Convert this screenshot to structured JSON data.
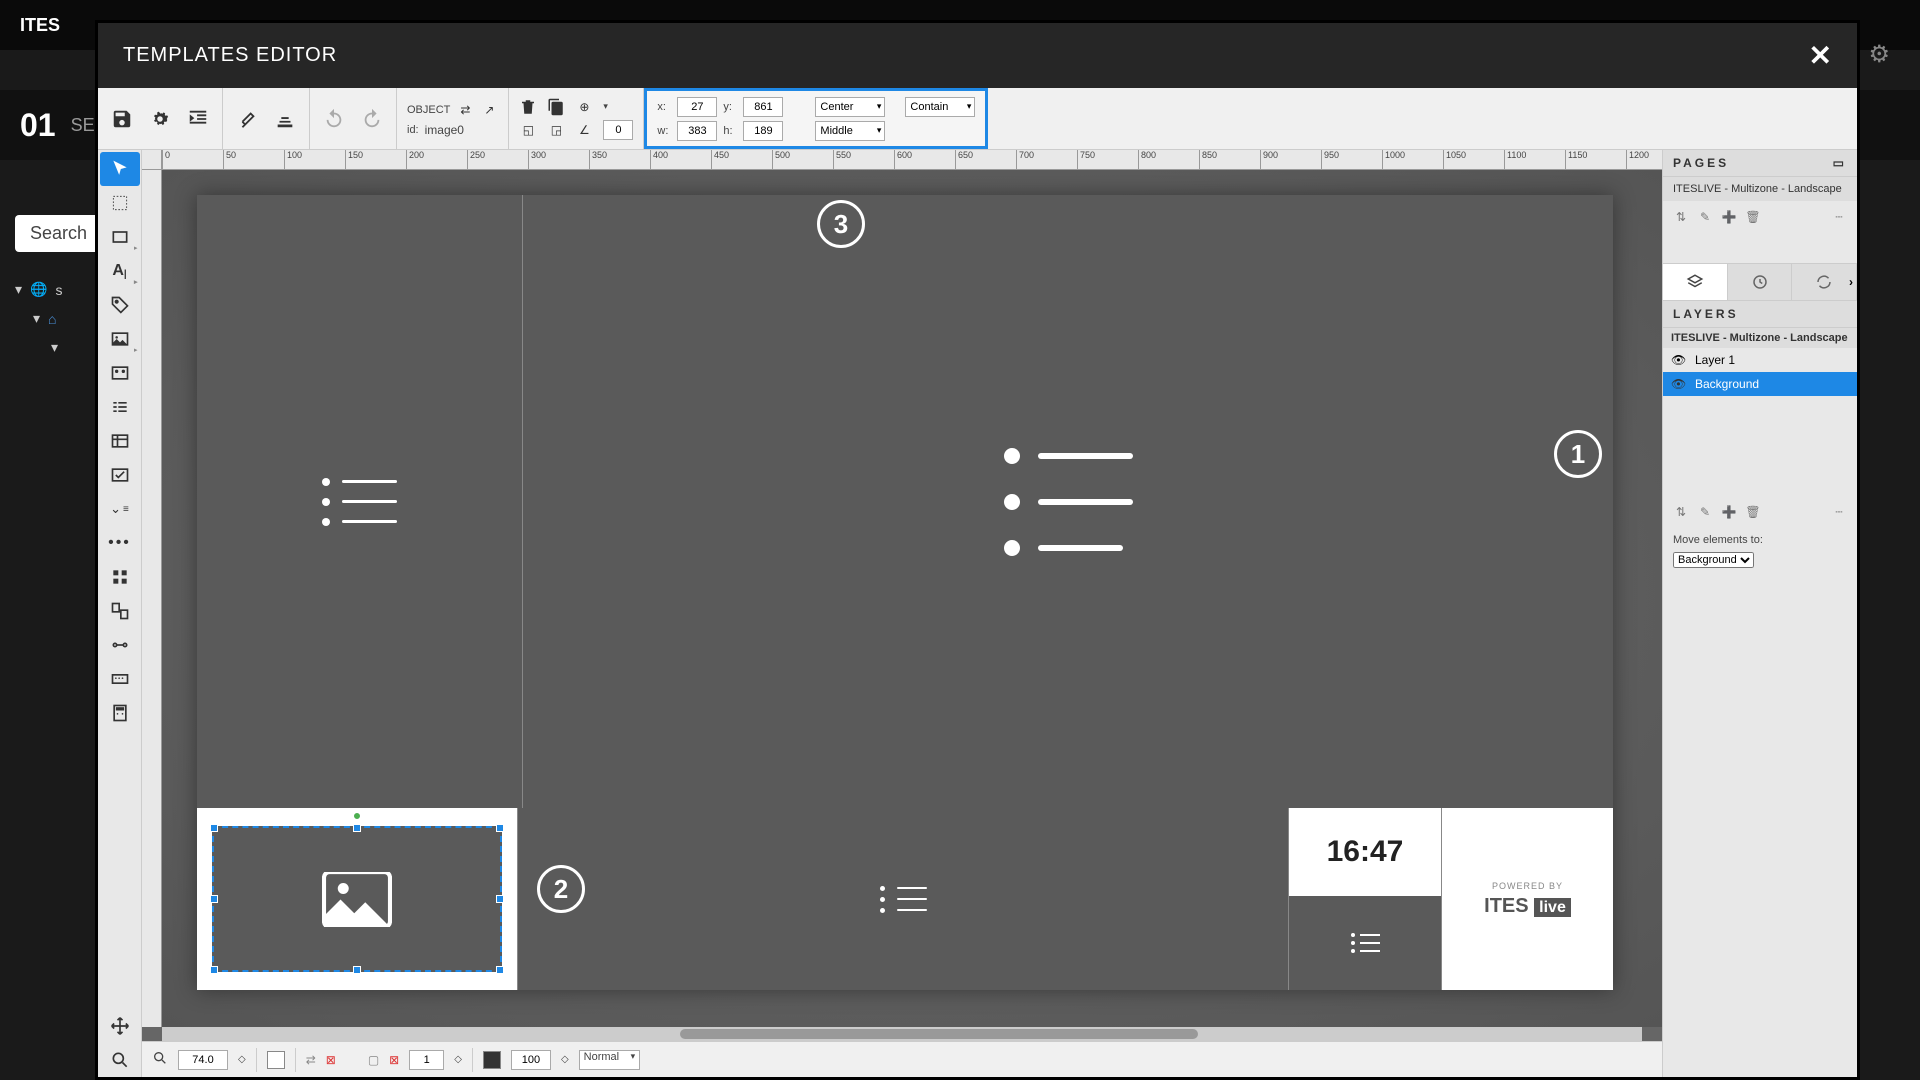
{
  "backdrop": {
    "title": "ITES",
    "num": "01",
    "sub": "SE",
    "search": "Search",
    "tree_s": "s"
  },
  "modal": {
    "title": "TEMPLATES EDITOR"
  },
  "object": {
    "label": "OBJECT",
    "id_label": "id:",
    "id_value": "image0",
    "rotation": "0"
  },
  "coords": {
    "x_label": "x:",
    "x": "27",
    "y_label": "y:",
    "y": "861",
    "w_label": "w:",
    "w": "383",
    "h_label": "h:",
    "h": "189",
    "align_h": "Center",
    "align_v": "Middle",
    "fit": "Contain"
  },
  "callouts": {
    "c1": "1",
    "c2": "2",
    "c3": "3"
  },
  "clock": {
    "time": "16:47"
  },
  "logo": {
    "powered": "POWERED BY",
    "brand": "ITES",
    "suffix": "live"
  },
  "pages": {
    "title": "PAGES",
    "item": "ITESLIVE - Multizone - Landscape"
  },
  "layers": {
    "title": "LAYERS",
    "page": "ITESLIVE - Multizone - Landscape",
    "l1": "Layer 1",
    "bg": "Background",
    "move_label": "Move elements to:",
    "move_value": "Background"
  },
  "status": {
    "zoom": "74.0",
    "opacity": "100",
    "blend": "Normal",
    "stroke": "1"
  },
  "ruler_ticks": [
    "0",
    "50",
    "100",
    "150",
    "200",
    "250",
    "300",
    "350",
    "400",
    "450",
    "500",
    "550",
    "600",
    "650",
    "700",
    "750",
    "800",
    "850",
    "900",
    "950",
    "1000",
    "1050",
    "1100",
    "1150",
    "1200"
  ]
}
